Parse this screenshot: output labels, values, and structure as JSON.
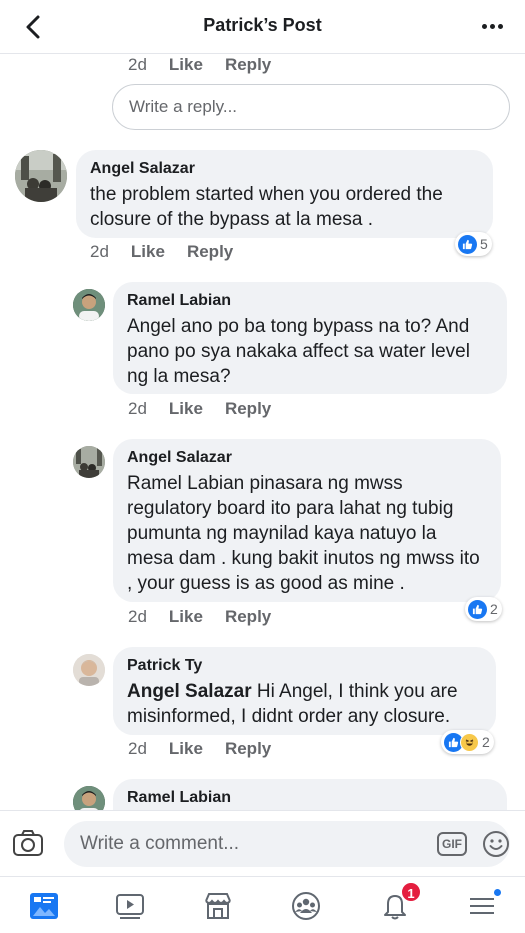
{
  "header": {
    "title": "Patrick’s Post"
  },
  "top_meta": {
    "time": "2d",
    "like": "Like",
    "reply": "Reply"
  },
  "reply_box": {
    "placeholder": "Write a reply..."
  },
  "comments": [
    {
      "author": "Angel Salazar",
      "text": "the problem started when you ordered the closure of the bypass at la mesa .",
      "time": "2d",
      "like": "Like",
      "reply": "Reply",
      "reactions": {
        "count": "5"
      }
    },
    {
      "author": "Ramel Labian",
      "text": "Angel ano po ba tong bypass na to? And pano po sya nakaka affect sa water level ng la mesa?",
      "time": "2d",
      "like": "Like",
      "reply": "Reply"
    },
    {
      "author": "Angel Salazar",
      "text": "Ramel Labian pinasara ng mwss regulatory board ito para lahat ng tubig pumunta ng maynilad kaya natuyo la mesa dam . kung bakit inutos ng mwss ito , your guess is as good as mine .",
      "time": "2d",
      "like": "Like",
      "reply": "Reply",
      "reactions": {
        "count": "2"
      }
    },
    {
      "author": "Patrick Ty",
      "mention": "Angel Salazar",
      "text": " Hi Angel, I think you are misinformed, I didnt order any closure.",
      "time": "2d",
      "like": "Like",
      "reply": "Reply",
      "reactions": {
        "count": "2"
      }
    },
    {
      "author": "Ramel Labian"
    }
  ],
  "composer": {
    "placeholder": "Write a comment...",
    "gif_label": "GIF"
  },
  "tabbar": {
    "notifications_badge": "1"
  },
  "colors": {
    "accent": "#1877f2",
    "bubble": "#f0f2f5",
    "badge": "#e41e3f"
  }
}
